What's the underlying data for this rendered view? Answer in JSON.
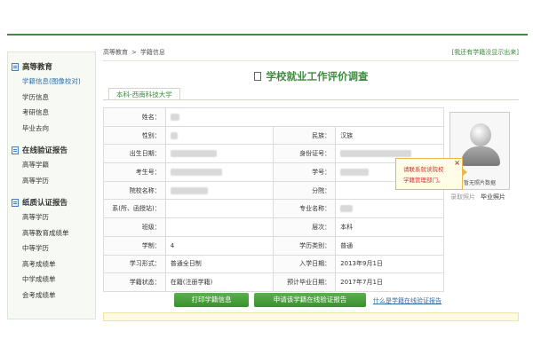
{
  "sidebar": {
    "sections": [
      {
        "title": "高等教育",
        "items": [
          "学籍信息(图像校对)",
          "学历信息",
          "考研信息",
          "毕业去向"
        ]
      },
      {
        "title": "在线验证报告",
        "items": [
          "高等学籍",
          "高等学历"
        ]
      },
      {
        "title": "纸质认证报告",
        "items": [
          "高等学历",
          "高等教育成绩单",
          "中等学历",
          "高考成绩单",
          "中学成绩单",
          "会考成绩单"
        ]
      }
    ]
  },
  "breadcrumb": {
    "root": "高等教育",
    "separator": ">",
    "current": "学籍信息"
  },
  "hide_link": "[我还有学籍没显示出来]",
  "page_title": "学校就业工作评价调查",
  "tab": "本科-西南科技大学",
  "table": {
    "rows": [
      [
        {
          "label": "姓名：",
          "value": ""
        }
      ],
      [
        {
          "label": "性别：",
          "value": ""
        },
        {
          "label": "民族：",
          "value": "汉族"
        }
      ],
      [
        {
          "label": "出生日期：",
          "value": ""
        },
        {
          "label": "身份证号：",
          "value": ""
        }
      ],
      [
        {
          "label": "考生号：",
          "value": ""
        },
        {
          "label": "学号：",
          "value": ""
        }
      ],
      [
        {
          "label": "院校名称：",
          "value": ""
        },
        {
          "label": "分院：",
          "value": ""
        }
      ],
      [
        {
          "label": "系(所、函授站)：",
          "value": ""
        },
        {
          "label": "专业名称：",
          "value": ""
        }
      ],
      [
        {
          "label": "班级：",
          "value": ""
        },
        {
          "label": "层次：",
          "value": "本科"
        }
      ],
      [
        {
          "label": "学制：",
          "value": "4"
        },
        {
          "label": "学历类别：",
          "value": "普通"
        }
      ],
      [
        {
          "label": "学习形式：",
          "value": "普通全日制"
        },
        {
          "label": "入学日期：",
          "value": "2013年9月1日"
        }
      ],
      [
        {
          "label": "学籍状态：",
          "value": "在籍(注册学籍)"
        },
        {
          "label": "预计毕业日期：",
          "value": "2017年7月1日"
        }
      ]
    ]
  },
  "photo": {
    "caption": "暂无照片数据",
    "left_label": "录取照片",
    "right_label": "毕业照片"
  },
  "tooltip": {
    "line1": "请联系就读院校",
    "line2": "学籍管理部门。",
    "close": "×"
  },
  "buttons": {
    "print": "打印学籍信息",
    "apply": "申请该学籍在线验证报告"
  },
  "what_link": "什么是学籍在线验证报告",
  "colors": {
    "accent": "#3d8c3d",
    "link": "#2f6fa6",
    "warn": "#cc3333"
  }
}
